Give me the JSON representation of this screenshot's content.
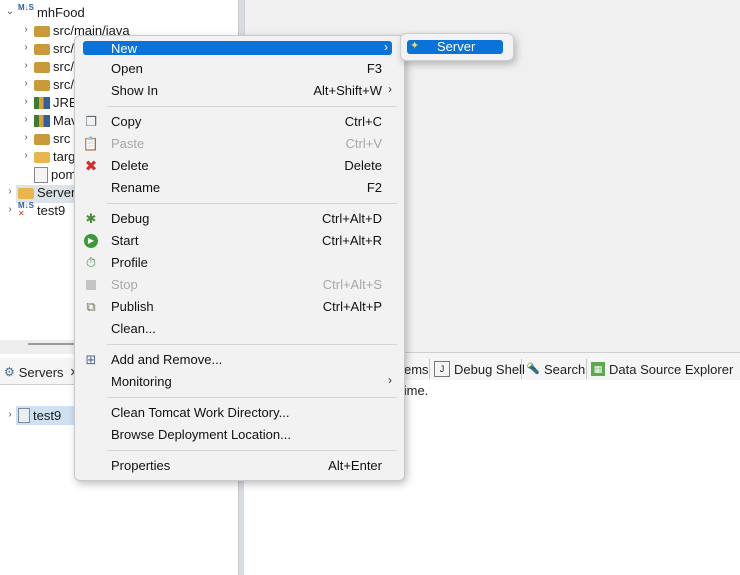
{
  "explorer": {
    "project": "mhFood",
    "rows": [
      {
        "label": "src/main/java"
      },
      {
        "label": "src/"
      },
      {
        "label": "src/"
      },
      {
        "label": "src/"
      },
      {
        "label": "JRE"
      },
      {
        "label": "Mav"
      },
      {
        "label": "src"
      },
      {
        "label": "targ"
      },
      {
        "label": "pom"
      }
    ],
    "servers_folder": "Servers",
    "test9_project": "test9"
  },
  "servers_view": {
    "tab_label": "Servers",
    "close_glyph": "✕",
    "server_entry": "test9"
  },
  "bottom_tabs": [
    {
      "label": "ems",
      "icon": "problems-icon"
    },
    {
      "label": "Debug Shell",
      "icon": "debug-shell-icon"
    },
    {
      "label": "Search",
      "icon": "search-icon"
    },
    {
      "label": "Data Source Explorer",
      "icon": "data-source-icon"
    }
  ],
  "status_text": "s time.",
  "context_menu": {
    "items": [
      {
        "label": "New",
        "accel": "",
        "submenu": true,
        "highlighted": true
      },
      {
        "label": "Open",
        "accel": "F3"
      },
      {
        "label": "Show In",
        "accel": "Alt+Shift+W",
        "submenu": true
      },
      {
        "label": "Copy",
        "accel": "Ctrl+C",
        "icon": "copy-icon"
      },
      {
        "label": "Paste",
        "accel": "Ctrl+V",
        "icon": "paste-icon",
        "disabled": true
      },
      {
        "label": "Delete",
        "accel": "Delete",
        "icon": "delete-icon"
      },
      {
        "label": "Rename",
        "accel": "F2"
      },
      {
        "label": "Debug",
        "accel": "Ctrl+Alt+D",
        "icon": "debug-icon"
      },
      {
        "label": "Start",
        "accel": "Ctrl+Alt+R",
        "icon": "start-icon"
      },
      {
        "label": "Profile",
        "accel": "",
        "icon": "profile-icon"
      },
      {
        "label": "Stop",
        "accel": "Ctrl+Alt+S",
        "icon": "stop-icon",
        "disabled": true
      },
      {
        "label": "Publish",
        "accel": "Ctrl+Alt+P",
        "icon": "publish-icon"
      },
      {
        "label": "Clean...",
        "accel": ""
      },
      {
        "label": "Add and Remove...",
        "accel": "",
        "icon": "add-remove-icon"
      },
      {
        "label": "Monitoring",
        "accel": "",
        "submenu": true
      },
      {
        "label": "Clean Tomcat Work Directory...",
        "accel": ""
      },
      {
        "label": "Browse Deployment Location...",
        "accel": ""
      },
      {
        "label": "Properties",
        "accel": "Alt+Enter"
      }
    ]
  },
  "submenu": {
    "items": [
      {
        "label": "Server",
        "icon": "server-icon"
      }
    ]
  },
  "colors": {
    "highlight": "#0a73d9",
    "menu_bg": "#f2f2f2",
    "disabled_text": "#a8a8a8"
  }
}
